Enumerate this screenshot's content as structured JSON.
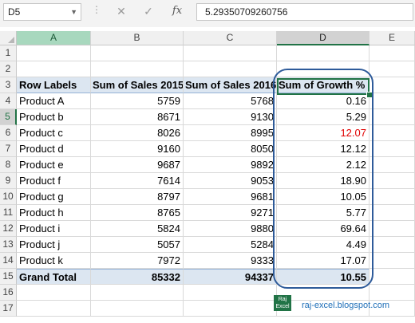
{
  "formula_bar": {
    "name_box": "D5",
    "formula_value": "5.29350709260756"
  },
  "columns": [
    "A",
    "B",
    "C",
    "D",
    "E"
  ],
  "rows": [
    {
      "num": "1",
      "label": "",
      "b": "",
      "c": "",
      "d": ""
    },
    {
      "num": "2",
      "label": "",
      "b": "",
      "c": "",
      "d": ""
    },
    {
      "num": "3",
      "label": "Row Labels",
      "b": "Sum of Sales 2015",
      "c": "Sum of Sales 2016",
      "d": "Sum of Growth %"
    },
    {
      "num": "4",
      "label": "Product A",
      "b": "5759",
      "c": "5768",
      "d": "0.16"
    },
    {
      "num": "5",
      "label": "Product b",
      "b": "8671",
      "c": "9130",
      "d": "5.29"
    },
    {
      "num": "6",
      "label": "Product c",
      "b": "8026",
      "c": "8995",
      "d": "12.07"
    },
    {
      "num": "7",
      "label": "Product d",
      "b": "9160",
      "c": "8050",
      "d": "12.12"
    },
    {
      "num": "8",
      "label": "Product e",
      "b": "9687",
      "c": "9892",
      "d": "2.12"
    },
    {
      "num": "9",
      "label": "Product f",
      "b": "7614",
      "c": "9053",
      "d": "18.90"
    },
    {
      "num": "10",
      "label": "Product g",
      "b": "8797",
      "c": "9681",
      "d": "10.05"
    },
    {
      "num": "11",
      "label": "Product h",
      "b": "8765",
      "c": "9271",
      "d": "5.77"
    },
    {
      "num": "12",
      "label": "Product i",
      "b": "5824",
      "c": "9880",
      "d": "69.64"
    },
    {
      "num": "13",
      "label": "Product j",
      "b": "5057",
      "c": "5284",
      "d": "4.49"
    },
    {
      "num": "14",
      "label": "Product k",
      "b": "7972",
      "c": "9333",
      "d": "17.07"
    },
    {
      "num": "15",
      "label": "Grand Total",
      "b": "85332",
      "c": "94337",
      "d": "10.55"
    },
    {
      "num": "16",
      "label": "",
      "b": "",
      "c": "",
      "d": ""
    },
    {
      "num": "17",
      "label": "",
      "b": "",
      "c": "",
      "d": ""
    }
  ],
  "colors": {
    "negative_growth": "#e00000",
    "pivot_header_fill": "#dce6f1",
    "selection_green": "#217346",
    "highlight_outline": "#2e5b9a"
  },
  "logo": {
    "line1": "Raj",
    "line2": "Excel"
  },
  "watermark": "raj-excel.blogspot.com"
}
